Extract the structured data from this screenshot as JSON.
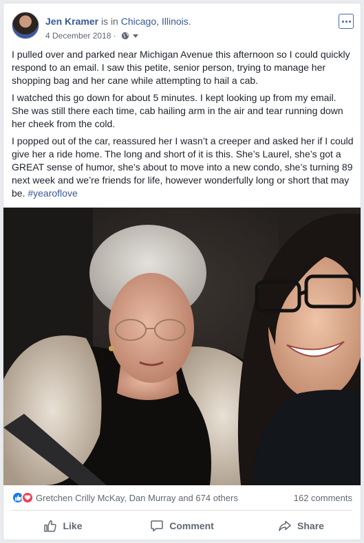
{
  "post": {
    "author": "Jen Kramer",
    "is_in": "is in",
    "location": "Chicago, Illinois",
    "location_period": ".",
    "date": "4 December 2018",
    "date_separator": "·",
    "privacy_icon": "globe-icon",
    "paragraphs": [
      "I pulled over and parked near Michigan Avenue this afternoon so I could quickly respond to an email. I saw this petite, senior person, trying to manage her shopping bag and her cane while attempting to hail a cab.",
      "I watched this go down for about 5 minutes. I kept looking up from my email. She was still there each time, cab hailing arm in the air and tear running down her cheek from the cold."
    ],
    "last_paragraph": "I popped out of the car, reassured her I wasn’t a creeper and asked her if I could give her a ride home. The long and short of it is this. She’s Laurel, she’s got a GREAT sense of humor, she’s about to move into a new condo, she’s turning 89 next week and we’re friends for life, however wonderfully long or short that may be.",
    "hashtag": "#yearoflove"
  },
  "reactions": {
    "icons": [
      "like-reaction-icon",
      "love-reaction-icon"
    ],
    "summary": "Gretchen Crilly McKay, Dan Murray and 674 others",
    "comments": "162 comments"
  },
  "actions": {
    "like": "Like",
    "comment": "Comment",
    "share": "Share"
  },
  "colors": {
    "link": "#385898",
    "secondary_text": "#606770",
    "like_blue": "#1877f2",
    "love_red": "#f33e58"
  }
}
